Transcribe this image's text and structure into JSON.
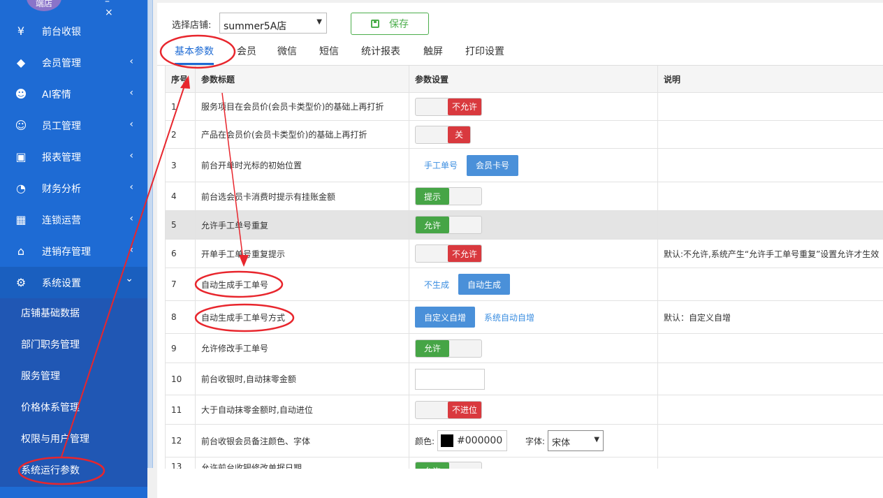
{
  "sidebar": {
    "avatar_text": "端店",
    "top_buttons": [
      "–",
      "×"
    ],
    "items": [
      {
        "label": "前台收银",
        "icon": "¥"
      },
      {
        "label": "会员管理",
        "icon": "◆"
      },
      {
        "label": "AI客情",
        "icon": "☻"
      },
      {
        "label": "员工管理",
        "icon": "☺"
      },
      {
        "label": "报表管理",
        "icon": "▣"
      },
      {
        "label": "财务分析",
        "icon": "◔"
      },
      {
        "label": "连锁运营",
        "icon": "▦"
      },
      {
        "label": "进销存管理",
        "icon": "⌂"
      },
      {
        "label": "系统设置",
        "icon": "⚙"
      }
    ],
    "chevron_closed": "‹",
    "chevron_open": "⌄",
    "submenu": [
      "店铺基础数据",
      "部门职务管理",
      "服务管理",
      "价格体系管理",
      "权限与用户管理",
      "系统运行参数"
    ]
  },
  "toolbar": {
    "store_label": "选择店铺:",
    "store_value": "summer5A店",
    "save_label": "保存"
  },
  "tabs": [
    "基本参数",
    "会员",
    "微信",
    "短信",
    "统计报表",
    "触屏",
    "打印设置"
  ],
  "table": {
    "headers": [
      "序号",
      "参数标题",
      "参数设置",
      "说明"
    ],
    "rows": [
      {
        "no": "1",
        "title": "服务项目在会员价(会员卡类型价)的基础上再打折",
        "toggle": "不允许",
        "note": ""
      },
      {
        "no": "2",
        "title": "产品在会员价(会员卡类型价)的基础上再打折",
        "toggle": "关",
        "note": ""
      },
      {
        "no": "3",
        "title": "前台开单时光标的初始位置",
        "opt_a": "手工单号",
        "opt_b": "会员卡号",
        "note": ""
      },
      {
        "no": "4",
        "title": "前台选会员卡消费时提示有挂账金额",
        "toggle": "提示",
        "note": ""
      },
      {
        "no": "5",
        "title": "允许手工单号重复",
        "toggle": "允许",
        "note": ""
      },
      {
        "no": "6",
        "title": "开单手工单号重复提示",
        "toggle": "不允许",
        "note": "默认:不允许,系统产生“允许手工单号重复”设置允许才生效"
      },
      {
        "no": "7",
        "title": "自动生成手工单号",
        "opt_a": "不生成",
        "opt_b": "自动生成",
        "note": ""
      },
      {
        "no": "8",
        "title": "自动生成手工单号方式",
        "opt_a": "自定义自增",
        "opt_b": "系统自动自增",
        "note": "默认：自定义自增"
      },
      {
        "no": "9",
        "title": "允许修改手工单号",
        "toggle": "允许",
        "note": ""
      },
      {
        "no": "10",
        "title": "前台收银时,自动抹零金额",
        "note": ""
      },
      {
        "no": "11",
        "title": "大于自动抹零金额时,自动进位",
        "toggle": "不进位",
        "note": ""
      },
      {
        "no": "12",
        "title": "前台收银会员备注颜色、字体",
        "color_label": "颜色:",
        "color_value": "#000000",
        "font_label": "字体:",
        "font_value": "宋体",
        "note": ""
      },
      {
        "no": "13",
        "title": "允许前台收银修改单据日期",
        "toggle": "允许",
        "note": ""
      }
    ]
  },
  "colors": {
    "sidebar": "#1e6bd4",
    "accent": "#1e6bd4",
    "on": "#46a546",
    "off": "#d9393e",
    "annotation": "#e8262d"
  }
}
